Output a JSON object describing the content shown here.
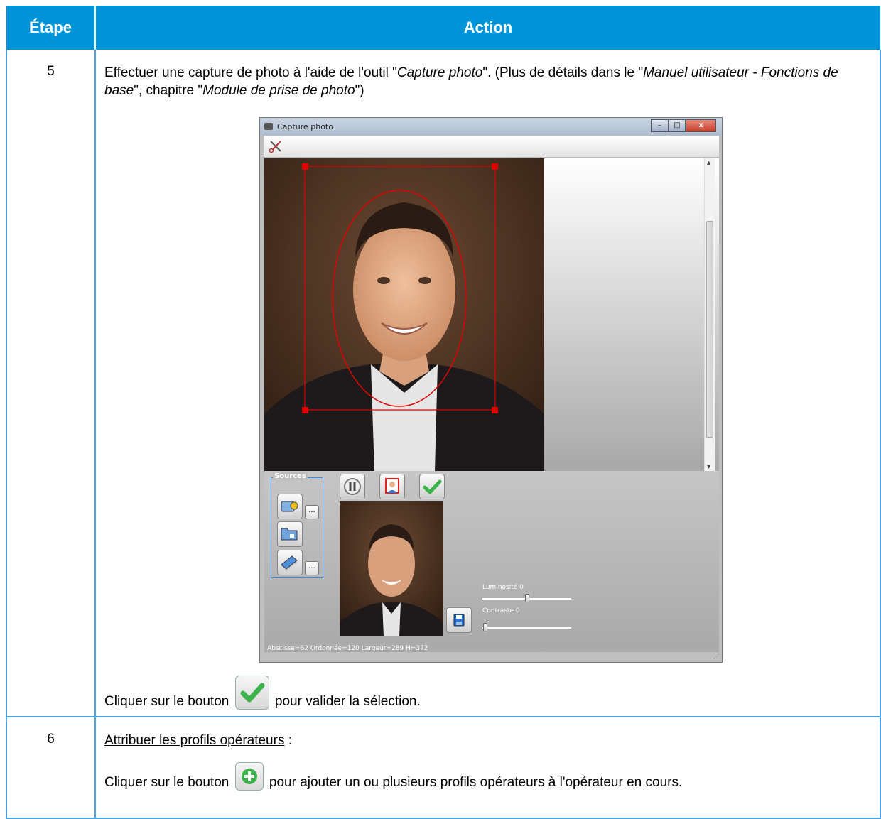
{
  "table": {
    "header_step": "Étape",
    "header_action": "Action"
  },
  "row5": {
    "step": "5",
    "text1_a": "Effectuer une capture de photo à l'aide de l'outil \"",
    "text1_b": "Capture photo",
    "text1_c": "\". (Plus de détails dans le \"",
    "text1_d": "Manuel utilisateur - Fonctions de base",
    "text1_e": "\", chapitre \"",
    "text1_f": "Module de prise de photo",
    "text1_g": "\")",
    "click_prefix": "Cliquer sur le bouton",
    "click_suffix": "pour valider la sélection."
  },
  "row6": {
    "step": "6",
    "heading": "Attribuer les profils opérateurs",
    "heading_suffix": " :",
    "click_prefix": "Cliquer sur le bouton",
    "click_suffix": "pour ajouter un ou plusieurs profils opérateurs à l'opérateur en cours."
  },
  "capture_window": {
    "title": "Capture photo",
    "sources_label": "Sources",
    "dots_label": "...",
    "luminosity_label": "Luminosité 0",
    "contrast_label": "Contraste 0",
    "luminosity_value": 0,
    "contrast_value": 0,
    "status_text": "Abscisse=62 Ordonnée=120 Largeur=289 H=372",
    "icons": [
      "scissors-icon",
      "camera-icon",
      "folder-icon",
      "scanner-icon",
      "pause-icon",
      "crop-portrait-icon",
      "checkmark-icon",
      "save-icon"
    ]
  },
  "colors": {
    "header_bg": "#0095d9",
    "border": "#4aa3df",
    "selection_red": "#e00000",
    "check_green": "#3bb34a"
  }
}
